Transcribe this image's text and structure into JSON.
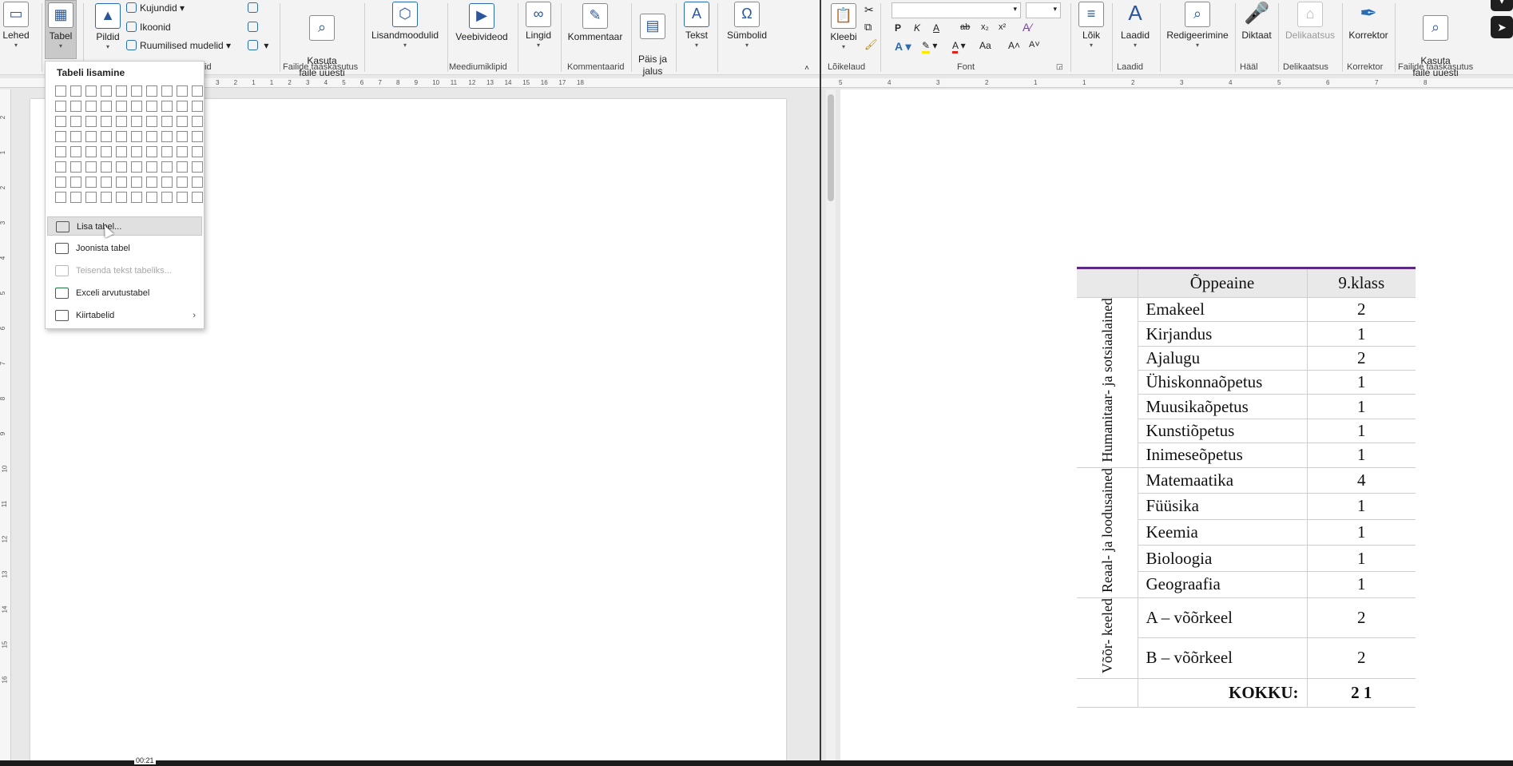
{
  "left_ribbon": {
    "buttons": [
      {
        "label": "Lehed",
        "icon": "pages-icon"
      },
      {
        "label": "Tabel",
        "icon": "table-icon"
      },
      {
        "label": "Pildid",
        "icon": "pictures-icon"
      },
      {
        "label": "Kasuta\nfaile uuesti",
        "icon": "reuse-files-icon"
      },
      {
        "label": "Lisandmoodulid",
        "icon": "addins-icon"
      },
      {
        "label": "Veebivideod",
        "icon": "online-video-icon"
      },
      {
        "label": "Lingid",
        "icon": "links-icon"
      },
      {
        "label": "Kommentaar",
        "icon": "comment-icon"
      },
      {
        "label": "Päis ja\njalus",
        "icon": "header-footer-icon"
      },
      {
        "label": "Tekst",
        "icon": "text-icon"
      },
      {
        "label": "Sümbolid",
        "icon": "symbols-icon"
      }
    ],
    "small": {
      "shapes": "Kujundid",
      "icons": "Ikoonid",
      "models": "Ruumilised mudelid"
    },
    "groups": {
      "illustrations_tail": "id",
      "reuse": "Failide taaskasutus",
      "media": "Meediumiklipid",
      "comments": "Kommentaarid"
    }
  },
  "right_ribbon": {
    "paste": "Kleebi",
    "font_buttons": {
      "bold": "P",
      "italic": "K",
      "underline": "A",
      "strike": "ab",
      "sub": "x₂",
      "sup": "x²",
      "grow": "A˄",
      "shrink": "A˅",
      "case": "Aa"
    },
    "buttons": [
      {
        "label": "Lõik",
        "icon": "paragraph-icon"
      },
      {
        "label": "Laadid",
        "icon": "styles-icon"
      },
      {
        "label": "Redigeerimine",
        "icon": "editing-icon"
      },
      {
        "label": "Diktaat",
        "icon": "microphone-icon"
      },
      {
        "label": "Delikaatsus",
        "icon": "sensitivity-icon"
      },
      {
        "label": "Korrektor",
        "icon": "editor-icon"
      },
      {
        "label": "Kasuta\nfaile uuesti",
        "icon": "reuse-files-icon"
      }
    ],
    "groups": {
      "clipboard": "Lõikelaud",
      "font": "Font",
      "styles": "Laadid",
      "voice": "Hääl",
      "sensitivity": "Delikaatsus",
      "editor": "Korrektor",
      "reuse": "Failide taaskasutus"
    }
  },
  "insert_table_menu": {
    "title": "Tabeli lisamine",
    "grid": {
      "columns": 10,
      "rows": 8
    },
    "items": [
      {
        "label": "Lisa tabel...",
        "icon": "table-icon",
        "state": "hover"
      },
      {
        "label": "Joonista tabel",
        "icon": "draw-table-icon",
        "state": "normal"
      },
      {
        "label": "Teisenda tekst tabeliks...",
        "icon": "convert-text-icon",
        "state": "disabled"
      },
      {
        "label": "Exceli arvutustabel",
        "icon": "excel-icon",
        "state": "normal"
      },
      {
        "label": "Kiirtabelid",
        "icon": "quick-tables-icon",
        "state": "normal",
        "submenu": true
      }
    ]
  },
  "ruler_left": [
    "3",
    "2",
    "1",
    "1",
    "2",
    "3",
    "4",
    "5",
    "6",
    "7",
    "8",
    "9",
    "10",
    "11",
    "12",
    "13",
    "14",
    "15",
    "16",
    "17",
    "18"
  ],
  "ruler_right": [
    "5",
    "4",
    "3",
    "2",
    "1",
    "1",
    "2",
    "3",
    "4",
    "5",
    "6",
    "7",
    "8"
  ],
  "document_table": {
    "header": {
      "subject": "Õppeaine",
      "grade": "9.klass"
    },
    "groups": [
      {
        "name": "Humanitaar- ja sotsiaalained",
        "rows": [
          {
            "subject": "Emakeel",
            "value": "2"
          },
          {
            "subject": "Kirjandus",
            "value": "1"
          },
          {
            "subject": "Ajalugu",
            "value": "2"
          },
          {
            "subject": "Ühiskonnaõpetus",
            "value": "1"
          },
          {
            "subject": "Muusikaõpetus",
            "value": "1"
          },
          {
            "subject": "Kunstiõpetus",
            "value": "1"
          },
          {
            "subject": "Inimeseõpetus",
            "value": "1"
          }
        ]
      },
      {
        "name": "Reaal- ja loodusained",
        "rows": [
          {
            "subject": "Matemaatika",
            "value": "4"
          },
          {
            "subject": "Füüsika",
            "value": "1"
          },
          {
            "subject": "Keemia",
            "value": "1"
          },
          {
            "subject": "Bioloogia",
            "value": "1"
          },
          {
            "subject": "Geograafia",
            "value": "1"
          }
        ]
      },
      {
        "name": "Võõr- keeled",
        "rows": [
          {
            "subject": "A – võõrkeel",
            "value": "2"
          },
          {
            "subject": "B – võõrkeel",
            "value": "2"
          }
        ]
      }
    ],
    "total": {
      "label": "KOKKU:",
      "value": "2 1"
    }
  },
  "video": {
    "time": "00:21"
  },
  "colors": {
    "table_accent": "#5b2a86",
    "ribbon_bg": "#f3f3f3",
    "accent_blue": "#2b579a"
  }
}
